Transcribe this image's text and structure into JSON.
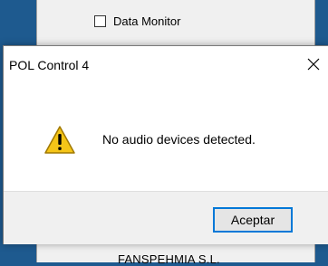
{
  "background_window": {
    "checkbox_label": "Data Monitor",
    "checkbox_checked": false,
    "bottom_text": "FANSPEHMIA S.L."
  },
  "dialog": {
    "title": "POL Control 4",
    "close_glyph": "✕",
    "icon": "warning-icon",
    "message": "No audio devices detected.",
    "ok_label": "Aceptar"
  }
}
